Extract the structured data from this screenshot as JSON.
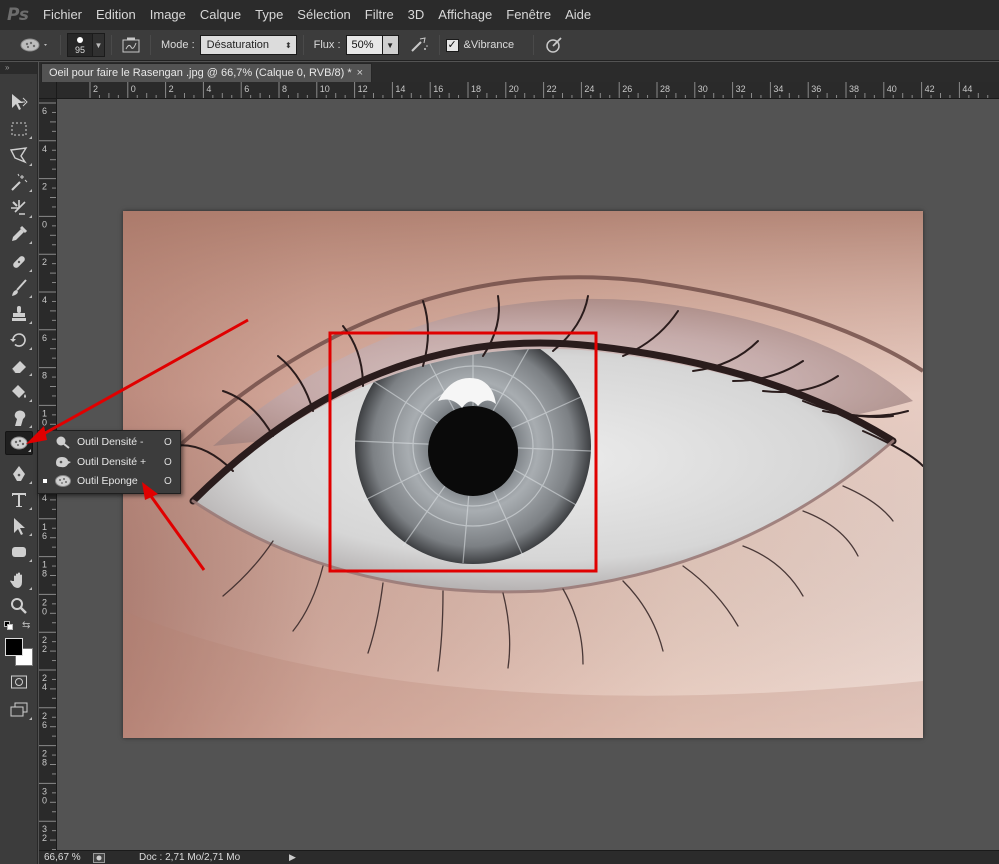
{
  "app": {
    "logo": "Ps"
  },
  "menu": [
    "Fichier",
    "Edition",
    "Image",
    "Calque",
    "Type",
    "Sélection",
    "Filtre",
    "3D",
    "Affichage",
    "Fenêtre",
    "Aide"
  ],
  "options": {
    "brush_size": "95",
    "mode_label": "Mode :",
    "mode_value": "Désaturation",
    "flux_label": "Flux :",
    "flux_value": "50%",
    "vibrance_label": "&Vibrance",
    "vibrance_checked": true
  },
  "document": {
    "tab_title": "Oeil pour faire le Rasengan .jpg @ 66,7% (Calque 0, RVB/8) *",
    "close_glyph": "×"
  },
  "ruler_top_labels": [
    "2",
    "0",
    "2",
    "4",
    "6",
    "8",
    "10",
    "12",
    "14",
    "16",
    "18",
    "20",
    "22",
    "24",
    "26",
    "28",
    "30",
    "32",
    "34",
    "36",
    "38",
    "40",
    "42",
    "44"
  ],
  "ruler_left_labels": [
    "6",
    "4",
    "2",
    "0",
    "2",
    "4",
    "6",
    "8",
    "1 0",
    "1 2",
    "1 4",
    "1 6",
    "1 8",
    "2 0",
    "2 2",
    "2 4",
    "2 6",
    "2 8",
    "3 0",
    "3 2"
  ],
  "flyout": [
    {
      "label": "Outil Densité -",
      "key": "O",
      "icon": "dodge-icon",
      "selected": false
    },
    {
      "label": "Outil Densité +",
      "key": "O",
      "icon": "burn-icon",
      "selected": false
    },
    {
      "label": "Outil Eponge",
      "key": "O",
      "icon": "sponge-icon",
      "selected": true
    }
  ],
  "status": {
    "zoom": "66,67 %",
    "doc_info": "Doc : 2,71 Mo/2,71 Mo",
    "arrow": "▶"
  },
  "colors": {
    "annotation": "#e00000",
    "foreground": "#000000",
    "background": "#ffffff"
  }
}
